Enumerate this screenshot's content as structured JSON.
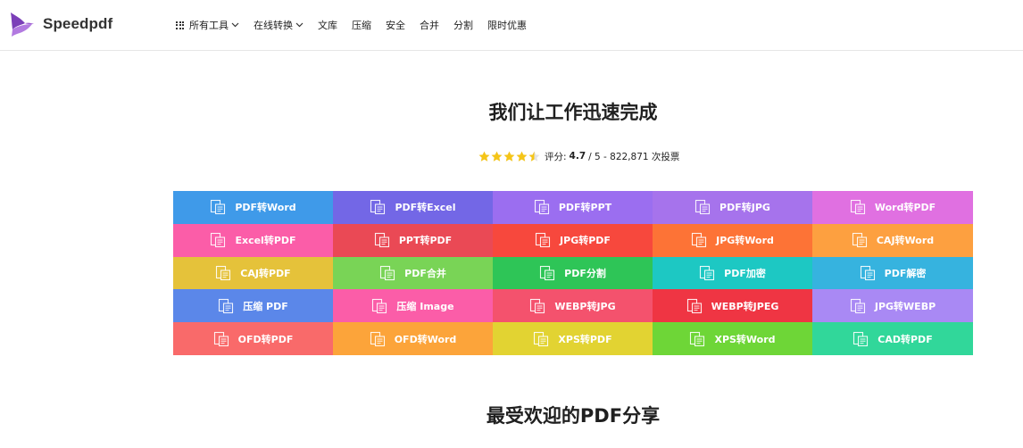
{
  "brand": {
    "name": "Speedpdf",
    "accent": "#9b59d0"
  },
  "nav": {
    "items": [
      {
        "label": "所有工具",
        "has_grid_icon": true,
        "has_chevron": true
      },
      {
        "label": "在线转换",
        "has_grid_icon": false,
        "has_chevron": true
      },
      {
        "label": "文库"
      },
      {
        "label": "压缩"
      },
      {
        "label": "安全"
      },
      {
        "label": "合并"
      },
      {
        "label": "分割"
      },
      {
        "label": "限时优惠"
      }
    ]
  },
  "hero": {
    "title": "我们让工作迅速完成",
    "rating": {
      "stars": 4.5,
      "prefix": "评分:",
      "score": "4.7",
      "suffix": "/ 5 - 822,871 次投票",
      "star_color": "#f5c518"
    }
  },
  "tools": [
    {
      "label": "PDF转Word",
      "color": "#3f9ae9",
      "icon": "pdf-to-word-icon"
    },
    {
      "label": "PDF转Excel",
      "color": "#7367e6",
      "icon": "pdf-to-excel-icon"
    },
    {
      "label": "PDF转PPT",
      "color": "#9b6ef0",
      "icon": "pdf-to-ppt-icon"
    },
    {
      "label": "PDF转JPG",
      "color": "#a673ec",
      "icon": "pdf-to-jpg-icon"
    },
    {
      "label": "Word转PDF",
      "color": "#e070e1",
      "icon": "word-to-pdf-icon"
    },
    {
      "label": "Excel转PDF",
      "color": "#fb5da8",
      "icon": "excel-to-pdf-icon"
    },
    {
      "label": "PPT转PDF",
      "color": "#ea4955",
      "icon": "ppt-to-pdf-icon"
    },
    {
      "label": "JPG转PDF",
      "color": "#f7483d",
      "icon": "jpg-to-pdf-icon"
    },
    {
      "label": "JPG转Word",
      "color": "#fd7336",
      "icon": "jpg-to-word-icon"
    },
    {
      "label": "CAJ转Word",
      "color": "#fda040",
      "icon": "caj-to-word-icon"
    },
    {
      "label": "CAJ转PDF",
      "color": "#e5c23a",
      "icon": "caj-to-pdf-icon"
    },
    {
      "label": "PDF合并",
      "color": "#79d456",
      "icon": "pdf-merge-icon"
    },
    {
      "label": "PDF分割",
      "color": "#2ec557",
      "icon": "pdf-split-icon"
    },
    {
      "label": "PDF加密",
      "color": "#1dc8c3",
      "icon": "pdf-encrypt-icon"
    },
    {
      "label": "PDF解密",
      "color": "#36b3df",
      "icon": "pdf-decrypt-icon"
    },
    {
      "label": "压缩 PDF",
      "color": "#5b87e9",
      "icon": "compress-pdf-icon"
    },
    {
      "label": "压缩 Image",
      "color": "#fb5da8",
      "icon": "compress-image-icon"
    },
    {
      "label": "WEBP转JPG",
      "color": "#f4526d",
      "icon": "webp-to-jpg-icon"
    },
    {
      "label": "WEBP转JPEG",
      "color": "#ef3543",
      "icon": "webp-to-jpeg-icon"
    },
    {
      "label": "JPG转WEBP",
      "color": "#a989f4",
      "icon": "jpg-to-webp-icon"
    },
    {
      "label": "OFD转PDF",
      "color": "#f96a6a",
      "icon": "ofd-to-pdf-icon"
    },
    {
      "label": "OFD转Word",
      "color": "#fca43a",
      "icon": "ofd-to-word-icon"
    },
    {
      "label": "XPS转PDF",
      "color": "#e2d332",
      "icon": "xps-to-pdf-icon"
    },
    {
      "label": "XPS转Word",
      "color": "#6ed637",
      "icon": "xps-to-word-icon"
    },
    {
      "label": "CAD转PDF",
      "color": "#31d79a",
      "icon": "cad-to-pdf-icon"
    }
  ],
  "section": {
    "title": "最受欢迎的PDF分享"
  }
}
